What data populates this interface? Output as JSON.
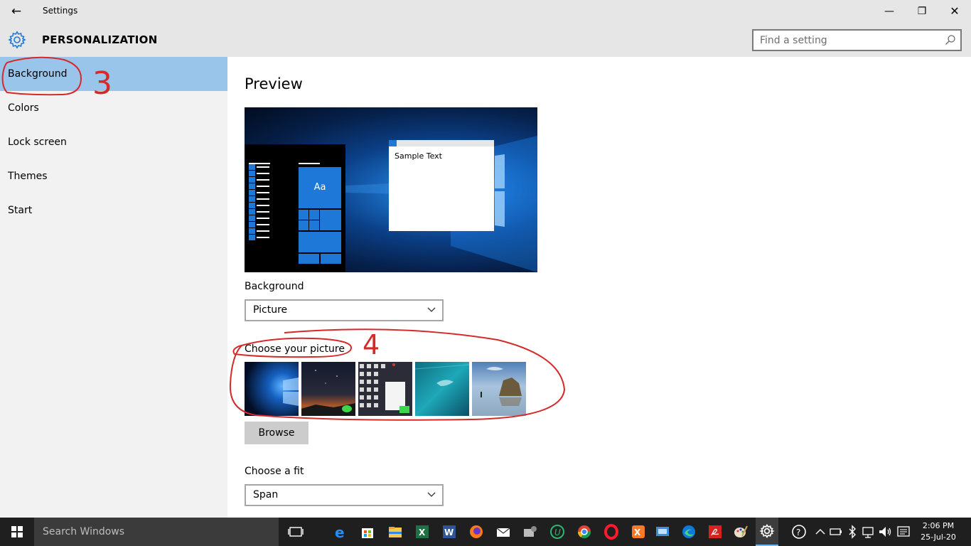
{
  "window": {
    "title": "Settings",
    "back_label": "←",
    "minimize_label": "—",
    "maximize_label": "❐",
    "close_label": "✕"
  },
  "header": {
    "section_title": "PERSONALIZATION",
    "search_placeholder": "Find a setting"
  },
  "sidebar": {
    "items": [
      {
        "label": "Background",
        "selected": true
      },
      {
        "label": "Colors"
      },
      {
        "label": "Lock screen"
      },
      {
        "label": "Themes"
      },
      {
        "label": "Start"
      }
    ]
  },
  "main": {
    "preview_heading": "Preview",
    "preview_sample_text": "Sample Text",
    "preview_tile_text": "Aa",
    "background_label": "Background",
    "background_value": "Picture",
    "choose_picture_label": "Choose your picture",
    "browse_label": "Browse",
    "fit_label": "Choose a fit",
    "fit_value": "Span"
  },
  "annotations": {
    "step_3": "3",
    "step_4": "4",
    "color": "#d42a2a"
  },
  "taskbar": {
    "search_placeholder": "Search Windows",
    "time": "2:06 PM",
    "date": "25-Jul-20"
  },
  "colors": {
    "accent": "#1e78d7",
    "selection": "#99c5ea",
    "sidebar_bg": "#f2f2f2",
    "header_bg": "#e6e6e6"
  }
}
